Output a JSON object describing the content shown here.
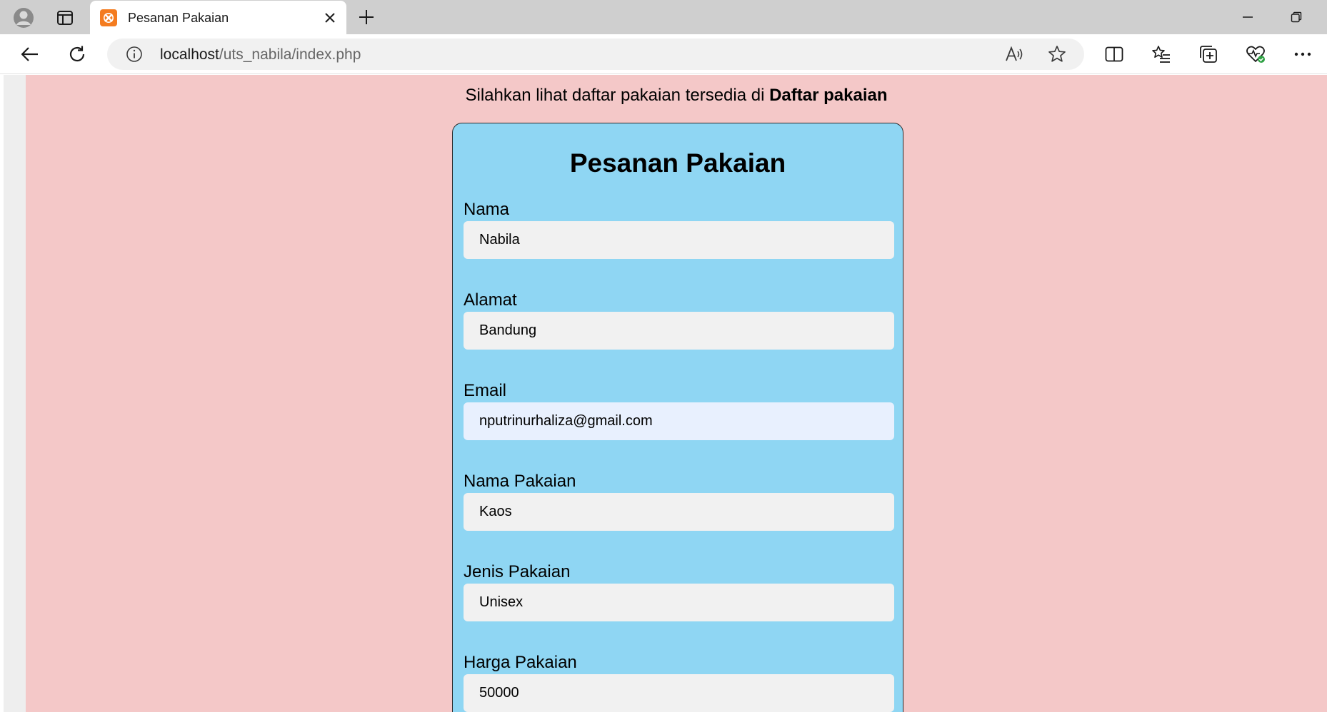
{
  "browser": {
    "tab": {
      "title": "Pesanan Pakaian"
    },
    "address": {
      "host": "localhost",
      "path": "/uts_nabila/index.php"
    }
  },
  "page": {
    "intro_text": "Silahkan lihat daftar pakaian tersedia di ",
    "intro_link": "Daftar pakaian",
    "form": {
      "title": "Pesanan Pakaian",
      "fields": [
        {
          "label": "Nama",
          "value": "Nabila"
        },
        {
          "label": "Alamat",
          "value": "Bandung"
        },
        {
          "label": "Email",
          "value": "nputrinurhaliza@gmail.com"
        },
        {
          "label": "Nama Pakaian",
          "value": "Kaos"
        },
        {
          "label": "Jenis Pakaian",
          "value": "Unisex"
        },
        {
          "label": "Harga Pakaian",
          "value": "50000"
        }
      ]
    }
  },
  "colors": {
    "page_background": "#f4c8c8",
    "card_background": "#8fd6f3",
    "input_background": "#f1f1f1",
    "autofill_background": "#e8f0fe",
    "favicon": "#f47c20"
  },
  "icons": {
    "profile": "profile-icon",
    "tab_actions": "tab-actions-icon",
    "favicon": "xampp-favicon-icon",
    "close_tab": "close-icon",
    "new_tab": "plus-icon",
    "minimize": "minimize-icon",
    "restore": "restore-icon",
    "back": "back-arrow-icon",
    "refresh": "refresh-icon",
    "site_info": "info-icon",
    "read_aloud": "read-aloud-icon",
    "favorite": "star-icon",
    "split_screen": "split-screen-icon",
    "favorites_list": "favorites-list-icon",
    "collections": "collections-icon",
    "browser_essentials": "heart-pulse-icon",
    "more": "more-dots-icon"
  }
}
